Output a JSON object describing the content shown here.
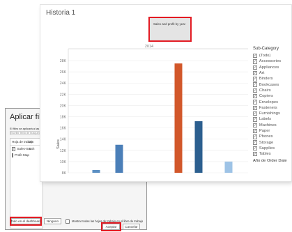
{
  "dialog": {
    "title": "Aplicar filtro",
    "description": "El filtro se aplicará a las hojas",
    "search_placeholder": "Escribir texto de búsqueda",
    "list": {
      "headers": [
        "Hoja de trabajo",
        "De"
      ],
      "rows": [
        {
          "checked": true,
          "name": "Sales-South",
          "source": "S"
        },
        {
          "checked": false,
          "name": "Profit Map",
          "source": ""
        }
      ]
    },
    "all_dashboard_button": "Todo en el dashboard",
    "none_button": "Ninguno",
    "show_all_sheets_label": "Mostrar todas las hojas de trabajo en el libro de trabajo",
    "accept_button": "Aceptar",
    "cancel_button": "Cancelar"
  },
  "sheet": {
    "title": "Historia 1",
    "tooltip_card_text": "Sales and profit by year"
  },
  "chart_data": {
    "type": "bar",
    "column_header": "2014",
    "ylabel": "Sales",
    "ylim": [
      8000,
      29000
    ],
    "yticks": [
      8000,
      10000,
      12000,
      14000,
      16000,
      18000,
      20000,
      22000,
      24000,
      26000,
      28000
    ],
    "ytick_labels": [
      "8K",
      "10K",
      "12K",
      "14K",
      "16K",
      "18K",
      "20K",
      "22K",
      "24K",
      "26K",
      "28K"
    ],
    "grid": true,
    "bars": [
      {
        "x_index": 0,
        "value": 8500,
        "color": "#5b8fc3"
      },
      {
        "x_index": 1,
        "value": 13000,
        "color": "#4b7fb8"
      },
      {
        "x_index": 2,
        "value": 27500,
        "color": "#d2572a"
      },
      {
        "x_index": 3,
        "value": 17200,
        "color": "#2c5f8f"
      },
      {
        "x_index": 4,
        "value": 10000,
        "color": "#9ec3e6"
      }
    ]
  },
  "legend": {
    "title": "Sub-Category",
    "items": [
      {
        "label": "(Todo)",
        "checked": true
      },
      {
        "label": "Accessories",
        "checked": true
      },
      {
        "label": "Appliances",
        "checked": true
      },
      {
        "label": "Art",
        "checked": true
      },
      {
        "label": "Binders",
        "checked": true
      },
      {
        "label": "Bookcases",
        "checked": true
      },
      {
        "label": "Chairs",
        "checked": true
      },
      {
        "label": "Copiers",
        "checked": true
      },
      {
        "label": "Envelopes",
        "checked": true
      },
      {
        "label": "Fasteners",
        "checked": true
      },
      {
        "label": "Furnishings",
        "checked": true
      },
      {
        "label": "Labels",
        "checked": true
      },
      {
        "label": "Machines",
        "checked": true
      },
      {
        "label": "Paper",
        "checked": true
      },
      {
        "label": "Phones",
        "checked": true
      },
      {
        "label": "Storage",
        "checked": true
      },
      {
        "label": "Supplies",
        "checked": true
      },
      {
        "label": "Tables",
        "checked": true
      }
    ],
    "footer_label": "Año de Order Date"
  },
  "colors": {
    "highlight": "#e31b23",
    "accent": "#d2572a"
  }
}
